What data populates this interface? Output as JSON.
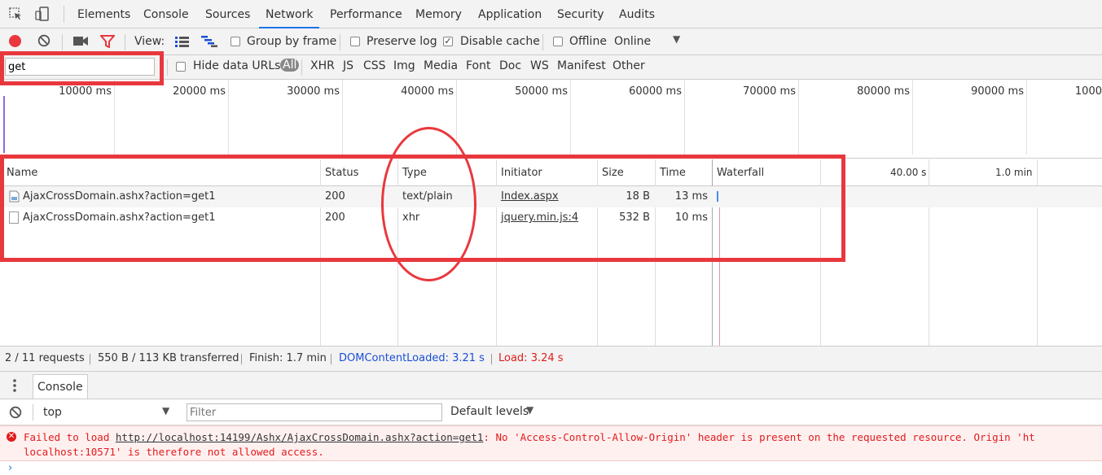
{
  "tabs": [
    "Elements",
    "Console",
    "Sources",
    "Network",
    "Performance",
    "Memory",
    "Application",
    "Security",
    "Audits"
  ],
  "toolbar": {
    "view_label": "View:",
    "group_by_frame": "Group by frame",
    "preserve_log": "Preserve log",
    "disable_cache": "Disable cache",
    "offline": "Offline",
    "throttling": "Online"
  },
  "filter": {
    "value": "get",
    "hide_data_urls": "Hide data URLs",
    "types": [
      "All",
      "XHR",
      "JS",
      "CSS",
      "Img",
      "Media",
      "Font",
      "Doc",
      "WS",
      "Manifest",
      "Other"
    ]
  },
  "overview_ticks": [
    "10000 ms",
    "20000 ms",
    "30000 ms",
    "40000 ms",
    "50000 ms",
    "60000 ms",
    "70000 ms",
    "80000 ms",
    "90000 ms",
    "1000"
  ],
  "columns": {
    "name": "Name",
    "status": "Status",
    "type": "Type",
    "initiator": "Initiator",
    "size": "Size",
    "time": "Time",
    "waterfall": "Waterfall",
    "wf_tick1": "40.00 s",
    "wf_tick2": "1.0 min"
  },
  "requests": [
    {
      "name": "AjaxCrossDomain.ashx?action=get1",
      "status": "200",
      "type": "text/plain",
      "initiator": "Index.aspx",
      "size": "18 B",
      "time": "13 ms"
    },
    {
      "name": "AjaxCrossDomain.ashx?action=get1",
      "status": "200",
      "type": "xhr",
      "initiator": "jquery.min.js:4",
      "size": "532 B",
      "time": "10 ms"
    }
  ],
  "status": {
    "requests": "2 / 11 requests",
    "transferred": "550 B / 113 KB transferred",
    "finish": "Finish: 1.7 min",
    "domcontentloaded": "DOMContentLoaded: 3.21 s",
    "load": "Load: 3.24 s"
  },
  "drawer": {
    "tab": "Console"
  },
  "console": {
    "context": "top",
    "filter_placeholder": "Filter",
    "levels": "Default levels",
    "error_prefix": "Failed to load ",
    "error_url": "http://localhost:14199/Ashx/AjaxCrossDomain.ashx?action=get1",
    "error_rest1": ": No 'Access-Control-Allow-Origin' header is present on the requested resource. Origin 'ht",
    "error_line2": "localhost:10571' is therefore not allowed access."
  },
  "colors": {
    "accent": "#1a73e8",
    "record": "#e8383d",
    "error": "#e21b1b",
    "dcl": "#1a4fd6",
    "annotation": "#e8383d"
  }
}
